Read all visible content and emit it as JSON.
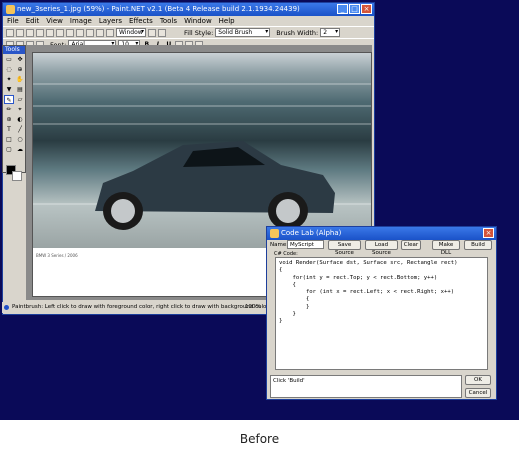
{
  "paintnet": {
    "title": "new_3series_1.jpg (59%) - Paint.NET v2.1 (Beta 4 Release build 2.1.1934.24439)",
    "menu": [
      "File",
      "Edit",
      "View",
      "Image",
      "Layers",
      "Effects",
      "Tools",
      "Window",
      "Help"
    ],
    "toolbar": {
      "window_combo": "Window",
      "fill_style_label": "Fill Style:",
      "fill_style_value": "Solid Brush",
      "brush_width_label": "Brush Width:",
      "brush_width_value": "2",
      "font_label": "Font:",
      "font_value": "Arial",
      "font_size_value": "10",
      "bold": "B",
      "italic": "I",
      "underline": "U"
    },
    "tools_title": "Tools",
    "doc_caption": "BMW 3 Series  /  2006",
    "status_text": "Paintbrush: Left click to draw with foreground color, right click to draw with background color",
    "zoom_text": "100%"
  },
  "codelab": {
    "title": "Code Lab (Alpha)",
    "name_label": "Name:",
    "name_value": "MyScript",
    "buttons": {
      "save_source": "Save Source",
      "load_source": "Load Source",
      "clear": "Clear",
      "make_dll": "Make DLL",
      "build": "Build",
      "ok": "OK",
      "cancel": "Cancel"
    },
    "code_label": "C# Code:",
    "code_lines": [
      "void Render(Surface dst, Surface src, Rectangle rect)",
      "{",
      "    for(int y = rect.Top; y < rect.Bottom; y++)",
      "    {",
      "        for (int x = rect.Left; x < rect.Right; x++)",
      "        {",
      "        }",
      "    }",
      "}"
    ],
    "output_text": "Click 'Build'"
  },
  "caption": "Before",
  "colors": {
    "desktop": "#0a0a58",
    "titlebar": "#1a52c8",
    "window_face": "#d9d5cc"
  }
}
